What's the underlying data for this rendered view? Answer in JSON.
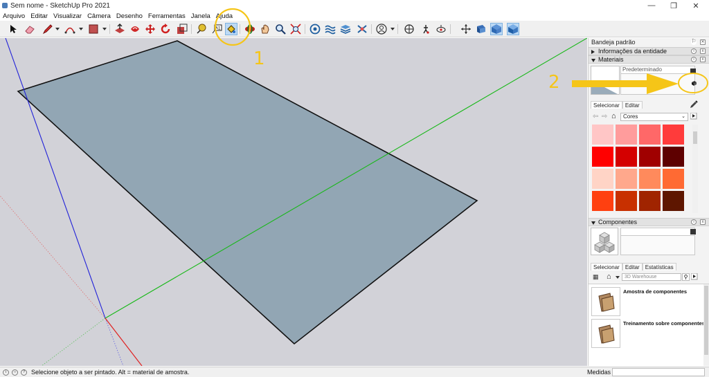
{
  "window": {
    "title": "Sem nome - SketchUp Pro 2021"
  },
  "menu": [
    "Arquivo",
    "Editar",
    "Visualizar",
    "Câmera",
    "Desenho",
    "Ferramentas",
    "Janela",
    "Ajuda"
  ],
  "toolbar": {
    "tools": [
      {
        "name": "select-icon"
      },
      {
        "name": "eraser-icon"
      },
      {
        "name": "pencil-icon"
      },
      {
        "name": "arc-icon"
      },
      {
        "name": "rectangle-icon"
      },
      {
        "name": "push-pull-icon"
      },
      {
        "name": "offset-icon"
      },
      {
        "name": "move-icon"
      },
      {
        "name": "rotate-icon"
      },
      {
        "name": "scale-icon"
      },
      {
        "name": "tape-measure-icon"
      },
      {
        "name": "text-icon"
      },
      {
        "name": "paint-bucket-icon"
      },
      {
        "name": "orbit-icon"
      },
      {
        "name": "pan-icon"
      },
      {
        "name": "zoom-icon"
      },
      {
        "name": "zoom-extents-icon"
      },
      {
        "name": "warehouse-icon"
      },
      {
        "name": "sandbox-icon"
      },
      {
        "name": "layers-icon"
      },
      {
        "name": "extension-icon"
      },
      {
        "name": "user-icon"
      },
      {
        "name": "position-camera-icon"
      },
      {
        "name": "walk-icon"
      },
      {
        "name": "look-around-icon"
      },
      {
        "name": "axes-icon"
      },
      {
        "name": "section-plane-icon"
      },
      {
        "name": "xray-view-icon"
      },
      {
        "name": "shaded-view-icon"
      },
      {
        "name": "textured-view-icon"
      }
    ],
    "text_tool_label": "A1"
  },
  "tray": {
    "title": "Bandeja padrão",
    "entity_info": "Informações da entidade",
    "materials": {
      "title": "Materiais",
      "current": "Predeterminado",
      "tabs": [
        "Selecionar",
        "Editar"
      ],
      "library": "Cores",
      "swatches": [
        "#ffc6c6",
        "#ff9c9c",
        "#ff6868",
        "#ff3b3b",
        "#ff0000",
        "#d40000",
        "#a00000",
        "#5e0000",
        "#ffd4c6",
        "#ffa88c",
        "#ff8a5c",
        "#ff6a33",
        "#ff4010",
        "#c83000",
        "#a02400",
        "#5e1600"
      ]
    },
    "components": {
      "title": "Componentes",
      "tabs": [
        "Selecionar",
        "Editar",
        "Estatísticas"
      ],
      "search_placeholder": "3D Warehouse",
      "items": [
        "Amostra de componentes",
        "Treinamento sobre componentes ..."
      ]
    }
  },
  "status": {
    "message": "Selecione objeto a ser pintado. Alt = material de amostra.",
    "measure_label": "Medidas"
  },
  "annotations": {
    "label_1": "1",
    "label_2": "2",
    "highlight_color": "#f5c518"
  },
  "colors": {
    "face": "#92a6b4",
    "axis_blue": "#2020d8",
    "axis_green": "#18b818",
    "axis_red": "#e02020",
    "viewport_bg": "#d2d2d8"
  }
}
